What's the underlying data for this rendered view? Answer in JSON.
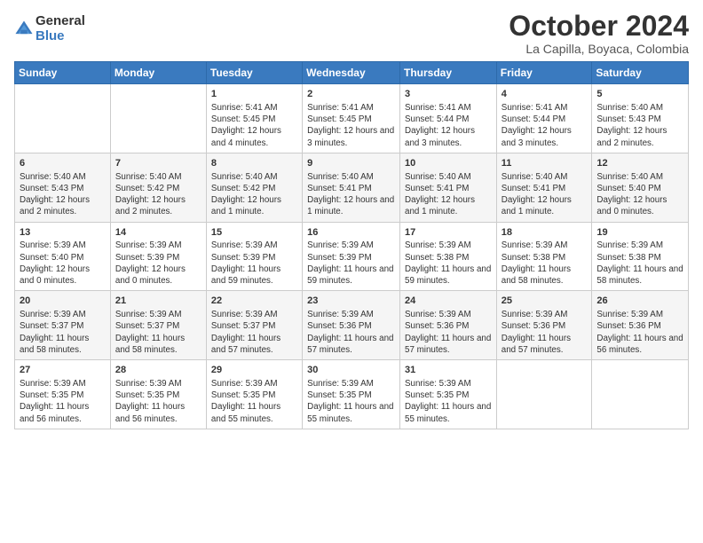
{
  "header": {
    "logo_general": "General",
    "logo_blue": "Blue",
    "month_title": "October 2024",
    "location": "La Capilla, Boyaca, Colombia"
  },
  "days_of_week": [
    "Sunday",
    "Monday",
    "Tuesday",
    "Wednesday",
    "Thursday",
    "Friday",
    "Saturday"
  ],
  "weeks": [
    [
      {
        "day": "",
        "info": ""
      },
      {
        "day": "",
        "info": ""
      },
      {
        "day": "1",
        "info": "Sunrise: 5:41 AM\nSunset: 5:45 PM\nDaylight: 12 hours and 4 minutes."
      },
      {
        "day": "2",
        "info": "Sunrise: 5:41 AM\nSunset: 5:45 PM\nDaylight: 12 hours and 3 minutes."
      },
      {
        "day": "3",
        "info": "Sunrise: 5:41 AM\nSunset: 5:44 PM\nDaylight: 12 hours and 3 minutes."
      },
      {
        "day": "4",
        "info": "Sunrise: 5:41 AM\nSunset: 5:44 PM\nDaylight: 12 hours and 3 minutes."
      },
      {
        "day": "5",
        "info": "Sunrise: 5:40 AM\nSunset: 5:43 PM\nDaylight: 12 hours and 2 minutes."
      }
    ],
    [
      {
        "day": "6",
        "info": "Sunrise: 5:40 AM\nSunset: 5:43 PM\nDaylight: 12 hours and 2 minutes."
      },
      {
        "day": "7",
        "info": "Sunrise: 5:40 AM\nSunset: 5:42 PM\nDaylight: 12 hours and 2 minutes."
      },
      {
        "day": "8",
        "info": "Sunrise: 5:40 AM\nSunset: 5:42 PM\nDaylight: 12 hours and 1 minute."
      },
      {
        "day": "9",
        "info": "Sunrise: 5:40 AM\nSunset: 5:41 PM\nDaylight: 12 hours and 1 minute."
      },
      {
        "day": "10",
        "info": "Sunrise: 5:40 AM\nSunset: 5:41 PM\nDaylight: 12 hours and 1 minute."
      },
      {
        "day": "11",
        "info": "Sunrise: 5:40 AM\nSunset: 5:41 PM\nDaylight: 12 hours and 1 minute."
      },
      {
        "day": "12",
        "info": "Sunrise: 5:40 AM\nSunset: 5:40 PM\nDaylight: 12 hours and 0 minutes."
      }
    ],
    [
      {
        "day": "13",
        "info": "Sunrise: 5:39 AM\nSunset: 5:40 PM\nDaylight: 12 hours and 0 minutes."
      },
      {
        "day": "14",
        "info": "Sunrise: 5:39 AM\nSunset: 5:39 PM\nDaylight: 12 hours and 0 minutes."
      },
      {
        "day": "15",
        "info": "Sunrise: 5:39 AM\nSunset: 5:39 PM\nDaylight: 11 hours and 59 minutes."
      },
      {
        "day": "16",
        "info": "Sunrise: 5:39 AM\nSunset: 5:39 PM\nDaylight: 11 hours and 59 minutes."
      },
      {
        "day": "17",
        "info": "Sunrise: 5:39 AM\nSunset: 5:38 PM\nDaylight: 11 hours and 59 minutes."
      },
      {
        "day": "18",
        "info": "Sunrise: 5:39 AM\nSunset: 5:38 PM\nDaylight: 11 hours and 58 minutes."
      },
      {
        "day": "19",
        "info": "Sunrise: 5:39 AM\nSunset: 5:38 PM\nDaylight: 11 hours and 58 minutes."
      }
    ],
    [
      {
        "day": "20",
        "info": "Sunrise: 5:39 AM\nSunset: 5:37 PM\nDaylight: 11 hours and 58 minutes."
      },
      {
        "day": "21",
        "info": "Sunrise: 5:39 AM\nSunset: 5:37 PM\nDaylight: 11 hours and 58 minutes."
      },
      {
        "day": "22",
        "info": "Sunrise: 5:39 AM\nSunset: 5:37 PM\nDaylight: 11 hours and 57 minutes."
      },
      {
        "day": "23",
        "info": "Sunrise: 5:39 AM\nSunset: 5:36 PM\nDaylight: 11 hours and 57 minutes."
      },
      {
        "day": "24",
        "info": "Sunrise: 5:39 AM\nSunset: 5:36 PM\nDaylight: 11 hours and 57 minutes."
      },
      {
        "day": "25",
        "info": "Sunrise: 5:39 AM\nSunset: 5:36 PM\nDaylight: 11 hours and 57 minutes."
      },
      {
        "day": "26",
        "info": "Sunrise: 5:39 AM\nSunset: 5:36 PM\nDaylight: 11 hours and 56 minutes."
      }
    ],
    [
      {
        "day": "27",
        "info": "Sunrise: 5:39 AM\nSunset: 5:35 PM\nDaylight: 11 hours and 56 minutes."
      },
      {
        "day": "28",
        "info": "Sunrise: 5:39 AM\nSunset: 5:35 PM\nDaylight: 11 hours and 56 minutes."
      },
      {
        "day": "29",
        "info": "Sunrise: 5:39 AM\nSunset: 5:35 PM\nDaylight: 11 hours and 55 minutes."
      },
      {
        "day": "30",
        "info": "Sunrise: 5:39 AM\nSunset: 5:35 PM\nDaylight: 11 hours and 55 minutes."
      },
      {
        "day": "31",
        "info": "Sunrise: 5:39 AM\nSunset: 5:35 PM\nDaylight: 11 hours and 55 minutes."
      },
      {
        "day": "",
        "info": ""
      },
      {
        "day": "",
        "info": ""
      }
    ]
  ]
}
